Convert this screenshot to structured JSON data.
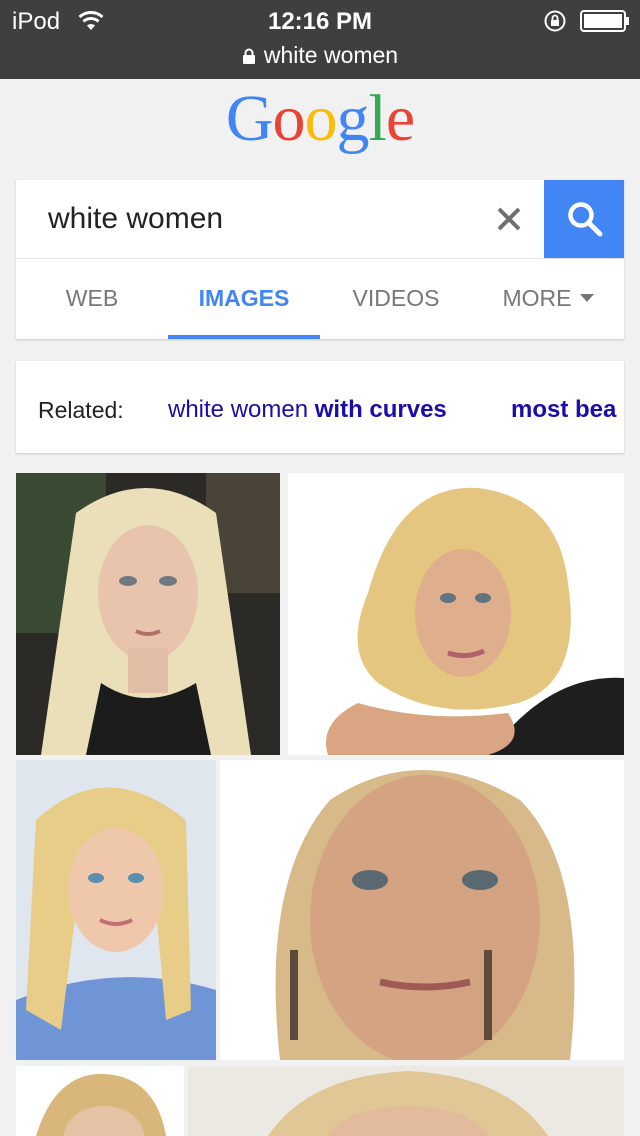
{
  "status_bar": {
    "device": "iPod",
    "time": "12:16 PM"
  },
  "url_bar": {
    "text": "white women"
  },
  "logo": {
    "letters": [
      "G",
      "o",
      "o",
      "g",
      "l",
      "e"
    ],
    "colors": [
      "#4285f4",
      "#ea4335",
      "#fbbc05",
      "#4285f4",
      "#34a853",
      "#ea4335"
    ]
  },
  "search": {
    "query": "white women",
    "accent_color": "#4285f4"
  },
  "tabs": [
    {
      "label": "WEB",
      "active": false
    },
    {
      "label": "IMAGES",
      "active": true
    },
    {
      "label": "VIDEOS",
      "active": false
    },
    {
      "label": "MORE",
      "active": false
    }
  ],
  "related": {
    "label": "Related:",
    "suggestions": [
      {
        "plain": "white women ",
        "bold": "with curves"
      },
      {
        "plain": "",
        "bold": "most bea"
      }
    ],
    "link_color": "#1a0dab"
  },
  "results": [
    {
      "name": "image-result-1"
    },
    {
      "name": "image-result-2"
    },
    {
      "name": "image-result-3"
    },
    {
      "name": "image-result-4"
    },
    {
      "name": "image-result-5"
    },
    {
      "name": "image-result-6"
    }
  ]
}
